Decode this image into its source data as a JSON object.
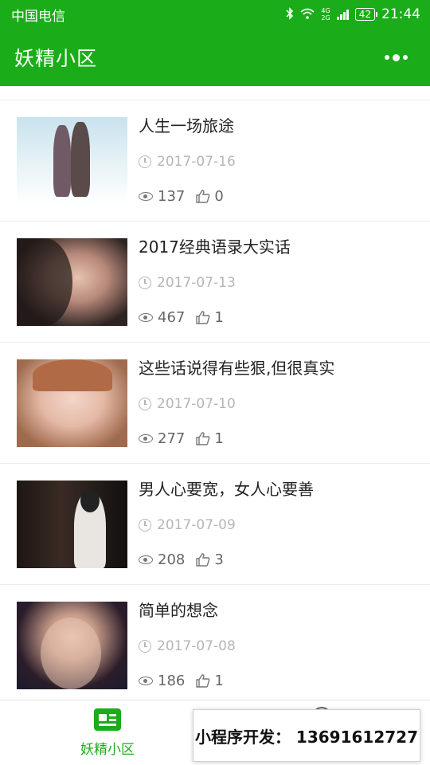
{
  "status_bar": {
    "carrier": "中国电信",
    "network_top": "4G",
    "network_bottom": "2G",
    "battery": "42",
    "time": "21:44"
  },
  "nav": {
    "title": "妖精小区"
  },
  "articles": [
    {
      "title": "人生一场旅途",
      "date": "2017-07-16",
      "views": "137",
      "likes": "0"
    },
    {
      "title": "2017经典语录大实话",
      "date": "2017-07-13",
      "views": "467",
      "likes": "1"
    },
    {
      "title": "这些话说得有些狠,但很真实",
      "date": "2017-07-10",
      "views": "277",
      "likes": "1"
    },
    {
      "title": "男人心要宽，女人心要善",
      "date": "2017-07-09",
      "views": "208",
      "likes": "3"
    },
    {
      "title": "简单的想念",
      "date": "2017-07-08",
      "views": "186",
      "likes": "1"
    }
  ],
  "tab_bar": {
    "tabs": [
      {
        "label": "妖精小区",
        "icon": "news-icon",
        "active": true
      }
    ]
  },
  "promo": {
    "text": "小程序开发： 13691612727"
  },
  "colors": {
    "brand_green": "#1aad19",
    "text_dark": "#222222",
    "text_muted": "#b6b6b6"
  }
}
